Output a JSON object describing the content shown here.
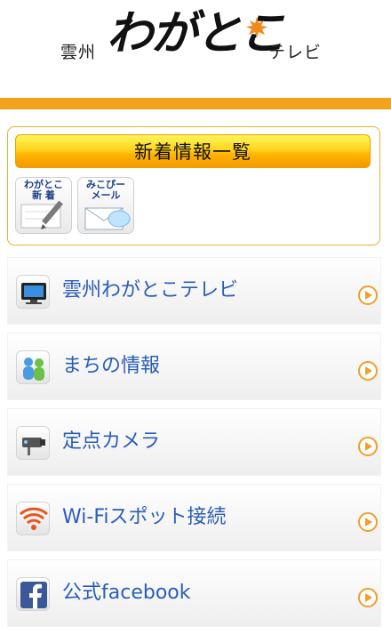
{
  "header": {
    "logo_left": "雲州",
    "logo_main": "わがとこ",
    "logo_right": "テレビ"
  },
  "news": {
    "button_label": "新着情報一覧",
    "tiles": [
      {
        "label": "わがとこ\n新 着"
      },
      {
        "label": "みこぴー\nメール"
      }
    ]
  },
  "menu": {
    "items": [
      {
        "label": "雲州わがとこテレビ",
        "icon": "tv-icon"
      },
      {
        "label": "まちの情報",
        "icon": "people-icon"
      },
      {
        "label": "定点カメラ",
        "icon": "camera-icon"
      },
      {
        "label": "Wi-Fiスポット接続",
        "icon": "wifi-icon"
      },
      {
        "label": "公式facebook",
        "icon": "facebook-icon"
      }
    ]
  },
  "colors": {
    "accent_bar": "#f3a21b",
    "menu_text": "#2a5db8",
    "arrow": "#f0a02a"
  }
}
